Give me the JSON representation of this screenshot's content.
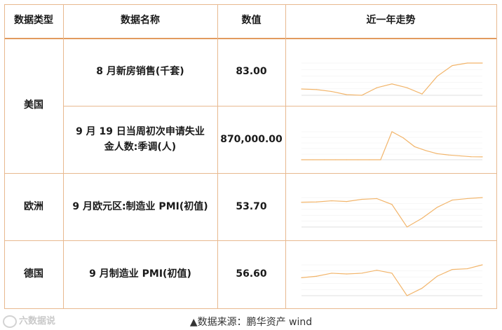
{
  "table": {
    "headers": [
      "数据类型",
      "数据名称",
      "数值",
      "近一年走势"
    ],
    "rows": [
      {
        "type": "",
        "name": "8 月新房销售(千套)",
        "value": "83.00"
      },
      {
        "type": "",
        "name": "9 月 19 日当周初次申请失业金人数:季调(人)",
        "value": "870,000.00"
      },
      {
        "type": "欧洲",
        "name": "9 月欧元区:制造业 PMI(初值)",
        "value": "53.70"
      },
      {
        "type": "德国",
        "name": "9 月制造业 PMI(初值)",
        "value": "56.60"
      }
    ],
    "group_label": "美国"
  },
  "chart_data": [
    {
      "type": "line",
      "values": [
        48,
        47,
        44,
        39,
        38,
        50,
        56,
        50,
        40,
        68,
        85,
        89,
        89
      ]
    },
    {
      "type": "line",
      "values": [
        0.21,
        0.21,
        0.21,
        0.21,
        0.21,
        0.21,
        0.21,
        0.21,
        6.6,
        5.2,
        3.2,
        2.3,
        1.6,
        1.3,
        1.1,
        0.9,
        0.87
      ]
    },
    {
      "type": "line",
      "values": [
        50.5,
        50.7,
        51.5,
        51,
        52.5,
        53,
        49,
        33.5,
        39.5,
        47,
        52,
        53,
        53.7
      ]
    },
    {
      "type": "line",
      "values": [
        48,
        49,
        51,
        50.5,
        51,
        53,
        51,
        36,
        41,
        49,
        53.5,
        54,
        56.6
      ]
    }
  ],
  "watermark": "六数据说",
  "footer": "▲数据来源：鹏华资产  wind",
  "colors": {
    "line": "#f2b56b",
    "border": "#e8b98f",
    "accent": "#e29a5e"
  }
}
